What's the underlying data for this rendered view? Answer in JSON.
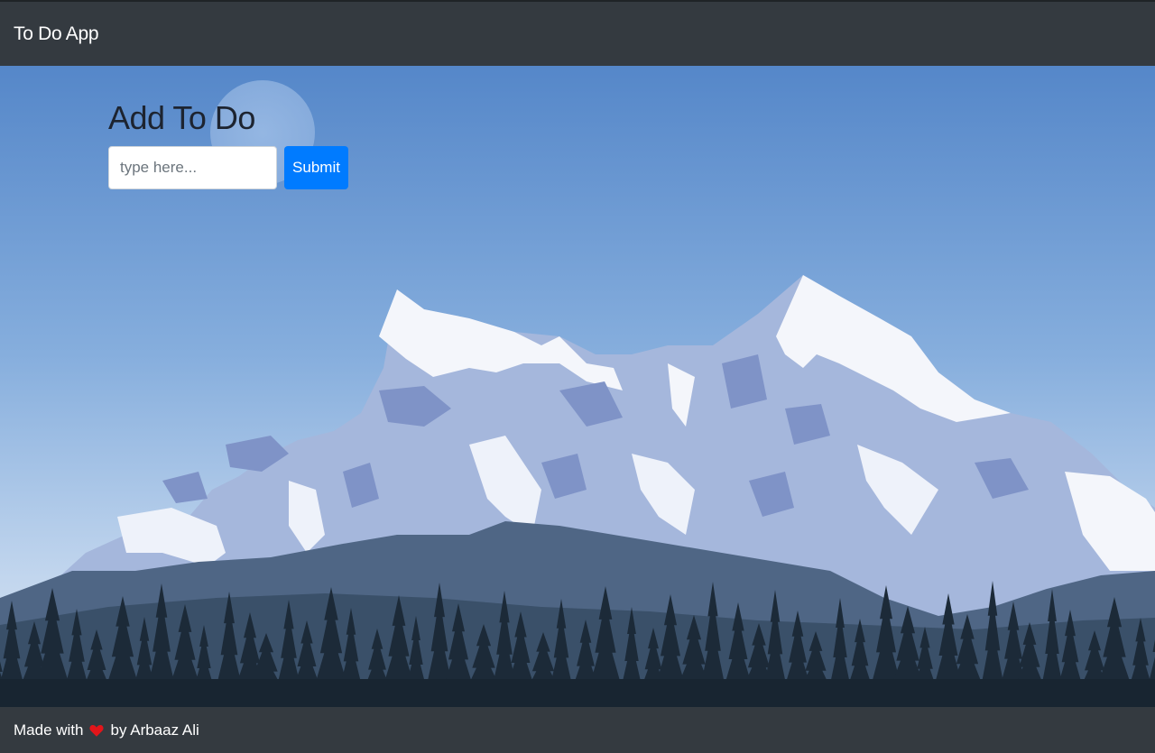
{
  "navbar": {
    "brand": "To Do App"
  },
  "form": {
    "title": "Add To Do",
    "input_placeholder": "type here...",
    "input_value": "",
    "submit_label": "Submit"
  },
  "footer": {
    "prefix": "Made with",
    "heart_icon": "heart-icon",
    "suffix": "by Arbaaz Ali"
  },
  "colors": {
    "navbar_bg": "#343a40",
    "button_bg": "#007bff",
    "heart": "#e3151a"
  }
}
